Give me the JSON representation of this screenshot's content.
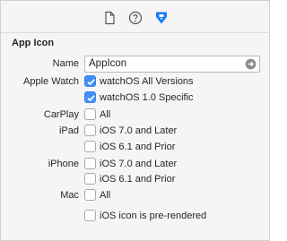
{
  "toolbar": {
    "tabs": [
      {
        "icon": "file-icon"
      },
      {
        "icon": "help-icon"
      },
      {
        "icon": "attributes-inspector-icon",
        "selected": true,
        "color": "#1d7bf2"
      }
    ]
  },
  "section": {
    "title": "App Icon"
  },
  "name_row": {
    "label": "Name",
    "value": "AppIcon"
  },
  "rows": [
    {
      "label": "Apple Watch",
      "options": [
        {
          "label": "watchOS All Versions",
          "checked": true
        },
        {
          "label": "watchOS 1.0 Specific",
          "checked": true
        }
      ]
    },
    {
      "label": "CarPlay",
      "options": [
        {
          "label": "All",
          "checked": false
        }
      ]
    },
    {
      "label": "iPad",
      "options": [
        {
          "label": "iOS 7.0 and Later",
          "checked": false
        },
        {
          "label": "iOS 6.1 and Prior",
          "checked": false
        }
      ]
    },
    {
      "label": "iPhone",
      "options": [
        {
          "label": "iOS 7.0 and Later",
          "checked": false
        },
        {
          "label": "iOS 6.1 and Prior",
          "checked": false
        }
      ]
    },
    {
      "label": "Mac",
      "options": [
        {
          "label": "All",
          "checked": false
        }
      ]
    }
  ],
  "prerendered": {
    "label": "iOS icon is pre-rendered",
    "checked": false
  },
  "colors": {
    "accent": "#3f8ff7",
    "selected_tab": "#1d7bf2"
  }
}
